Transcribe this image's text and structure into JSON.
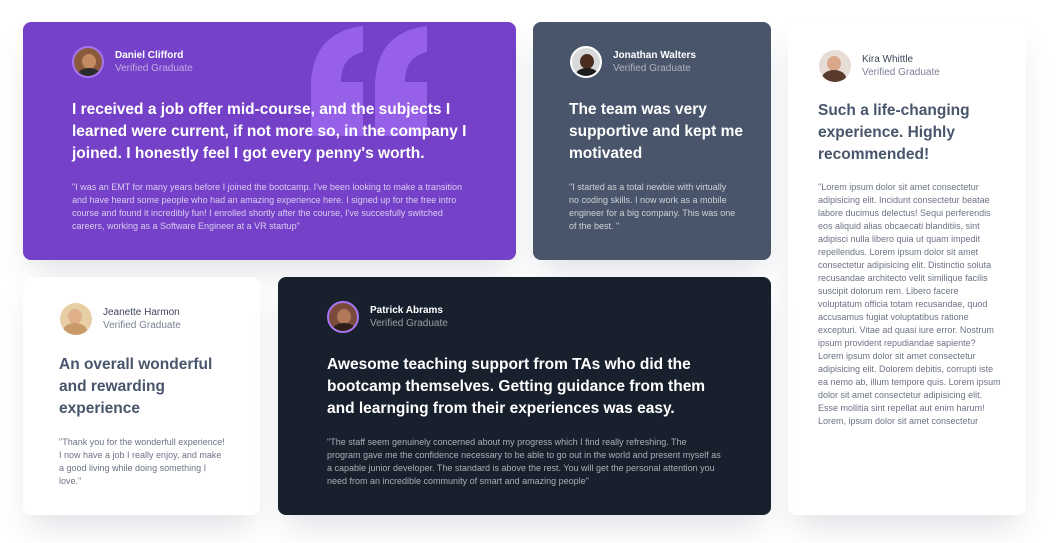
{
  "colors": {
    "violet": "#7541c8",
    "grayish_blue": "#48556a",
    "dark_blue": "#19202d",
    "light_violet": "#a775f1",
    "white": "#ffffff"
  },
  "testimonials": [
    {
      "name": "Daniel Clifford",
      "role": "Verified Graduate",
      "avatar_icon": "avatar-daniel",
      "headline": "I received a job offer mid-course, and the subjects I learned were current, if not more so, in the company I joined. I honestly feel I got every penny's worth.",
      "quote": "\"I was an EMT for many years before I joined the bootcamp. I've been looking to make a transition and have heard some people who had an amazing experience here. I signed up for the free intro course and found it incredibly fun! I enrolled shortly after the course, I've succesfully switched careers, working as a Software Engineer at a VR startup\""
    },
    {
      "name": "Jonathan Walters",
      "role": "Verified Graduate",
      "avatar_icon": "avatar-jonathan",
      "headline": "The team was very supportive and kept me motivated",
      "quote": "\"I started as a total newbie with virtually no coding skills. I now work as a mobile engineer for a big company. This was one of the best. \""
    },
    {
      "name": "Kira Whittle",
      "role": "Verified Graduate",
      "avatar_icon": "avatar-kira",
      "headline": "Such a life-changing experience. Highly recommended!",
      "quote": "\"Lorem ipsum dolor sit amet consectetur adipisicing elit. Incidunt consectetur beatae labore ducimus delectus! Sequi perferendis eos aliquid alias obcaecati blanditiis, sint adipisci nulla libero quia ut quam impedit repellendus. Lorem ipsum dolor sit amet consectetur adipisicing elit. Distinctio soluta recusandae architecto velit similique facilis suscipit dolorum rem. Libero facere voluptatum officia totam recusandae, quod accusamus fugiat voluptatibus ratione excepturi. Vitae ad quasi iure error. Nostrum ipsum provident repudiandae sapiente? Lorem ipsum dolor sit amet consectetur adipisicing elit. Dolorem debitis, corrupti iste ea nemo ab, illum tempore quis. Lorem ipsum dolor sit amet consectetur adipisicing elit. Esse mollitia sint repellat aut enim harum! Lorem, ipsum dolor sit amet consectetur"
    },
    {
      "name": "Jeanette Harmon",
      "role": "Verified Graduate",
      "avatar_icon": "avatar-jeanette",
      "headline": "An overall wonderful and rewarding experience",
      "quote": "\"Thank you for the wonderfull experience! I now have a job I really enjoy, and make a good living while doing something I love.\""
    },
    {
      "name": "Patrick Abrams",
      "role": "Verified Graduate",
      "avatar_icon": "avatar-patrick",
      "headline": "Awesome teaching support from TAs who did the bootcamp themselves. Getting guidance from them and learnging from their experiences was easy.",
      "quote": "\"The staff seem genuinely concerned about my progress which I find really refreshing. The program gave me the confidence necessary to be able to go out in the world and present myself as a capable junior developer. The standard is above the rest. You will get the personal attention you need from an incredible community of smart and amazing people\""
    }
  ]
}
